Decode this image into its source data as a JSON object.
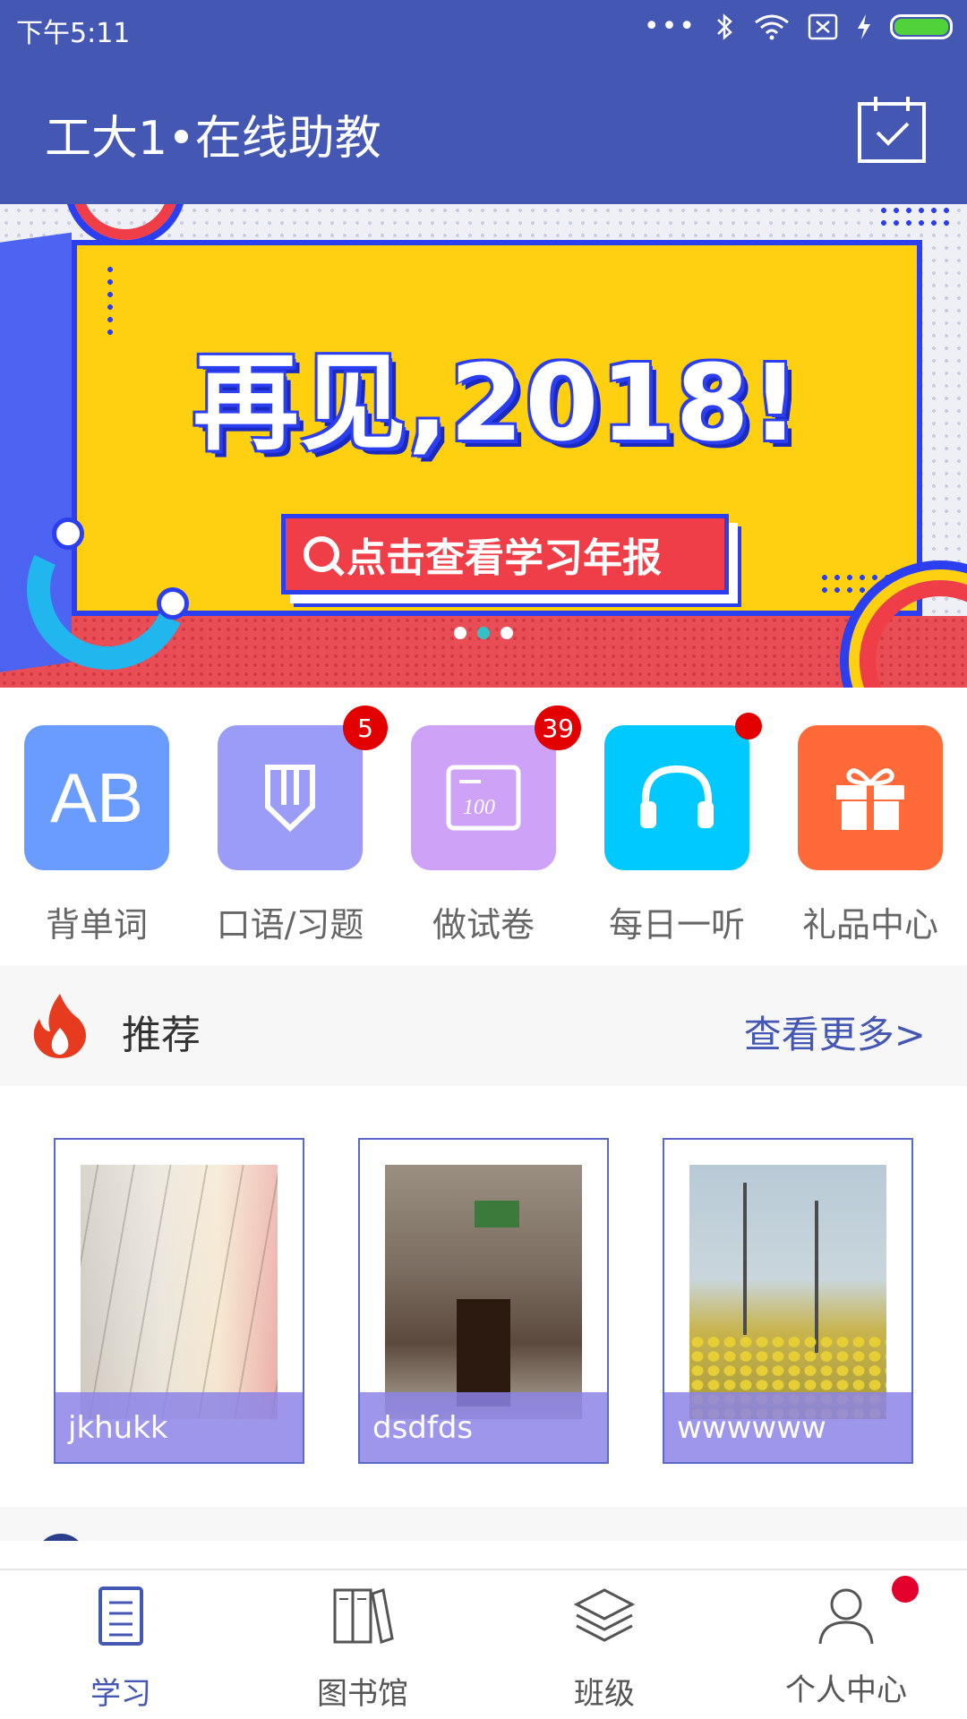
{
  "status_bar": {
    "time": "下午5:11",
    "more": "•••"
  },
  "app_bar": {
    "title": "工大1•在线助教"
  },
  "banner": {
    "headline": "再见,2018!",
    "button_label": "点击查看学习年报",
    "page_count": 3,
    "active_page": 2
  },
  "quick_menu": [
    {
      "label": "背单词",
      "tile_text": "AB",
      "color": "#6a9cff",
      "badge": ""
    },
    {
      "label": "口语/习题",
      "color": "#9b9cf7",
      "badge": "5"
    },
    {
      "label": "做试卷",
      "color": "#cda2f7",
      "badge": "39",
      "tile_text": "100"
    },
    {
      "label": "每日一听",
      "color": "#00c9ff",
      "badge_dot": true
    },
    {
      "label": "礼品中心",
      "color": "#ff6a38",
      "badge": ""
    }
  ],
  "recommend": {
    "title": "推荐",
    "more_label": "查看更多>",
    "items": [
      {
        "caption": "jkhukk"
      },
      {
        "caption": "dsdfds"
      },
      {
        "caption": "wwwwww"
      }
    ]
  },
  "tab_bar": {
    "tabs": [
      {
        "label": "学习",
        "active": true
      },
      {
        "label": "图书馆",
        "active": false
      },
      {
        "label": "班级",
        "active": false
      },
      {
        "label": "个人中心",
        "active": false,
        "dot": true
      }
    ]
  },
  "colors": {
    "primary": "#4457b3",
    "badge_red": "#e30000",
    "caption_bg": "#8c84e6"
  }
}
